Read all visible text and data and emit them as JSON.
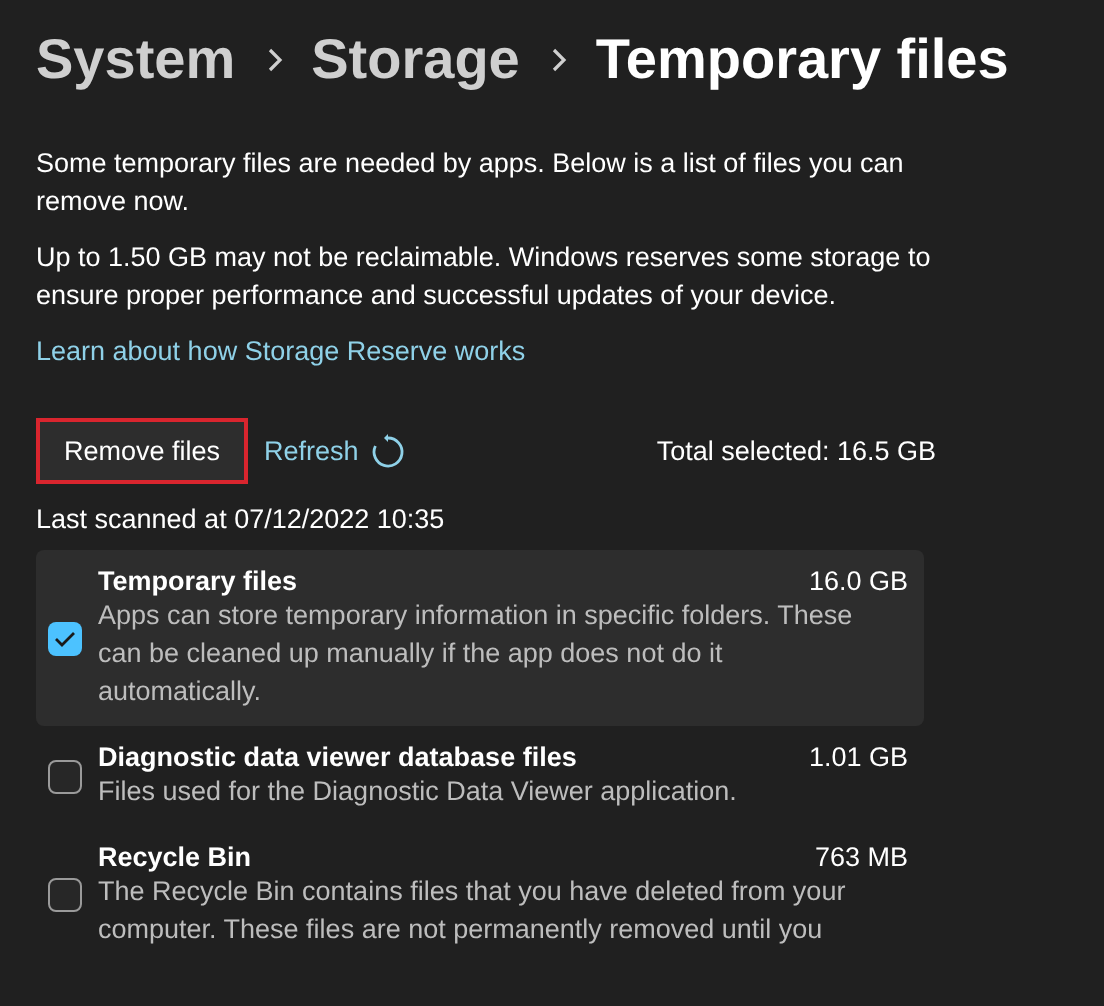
{
  "breadcrumb": [
    {
      "label": "System",
      "current": false
    },
    {
      "label": "Storage",
      "current": false
    },
    {
      "label": "Temporary files",
      "current": true
    }
  ],
  "intro": "Some temporary files are needed by apps. Below is a list of files you can remove now.",
  "reserve_note": "Up to 1.50 GB may not be reclaimable. Windows reserves some storage to ensure proper performance and successful updates of your device.",
  "learn_link": "Learn about how Storage Reserve works",
  "remove_button": {
    "label": "Remove files",
    "highlighted": true
  },
  "refresh_link": "Refresh",
  "total_selected": "Total selected: 16.5 GB",
  "last_scanned": "Last scanned at 07/12/2022 10:35",
  "items": [
    {
      "title": "Temporary files",
      "size": "16.0 GB",
      "description": "Apps can store temporary information in specific folders. These can be cleaned up manually if the app does not do it automatically.",
      "checked": true,
      "selected": true
    },
    {
      "title": "Diagnostic data viewer database files",
      "size": "1.01 GB",
      "description": "Files used for the Diagnostic Data Viewer application.",
      "checked": false,
      "selected": false
    },
    {
      "title": "Recycle Bin",
      "size": "763 MB",
      "description": "The Recycle Bin contains files that you have deleted from your computer. These files are not permanently removed until you",
      "checked": false,
      "selected": false
    }
  ]
}
